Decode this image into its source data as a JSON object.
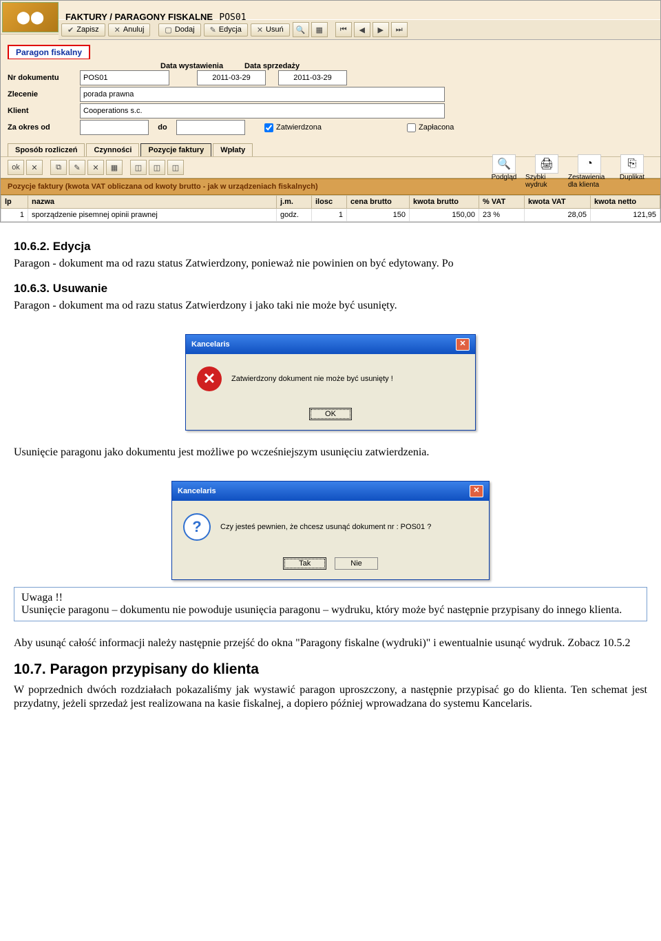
{
  "app": {
    "title": "FAKTURY / PARAGONY FISKALNE",
    "posno": "POS01",
    "toolbar": {
      "zapisz": "Zapisz",
      "anuluj": "Anuluj",
      "dodaj": "Dodaj",
      "edycja": "Edycja",
      "usun": "Usuń"
    },
    "tab": "Paragon fiskalny",
    "labels": {
      "nrdok": "Nr dokumentu",
      "data_wyst": "Data wystawienia",
      "data_sprz": "Data sprzedaży",
      "zlecenie": "Zlecenie",
      "klient": "Klient",
      "zaokres": "Za okres od",
      "do": "do",
      "zatw": "Zatwierdzona",
      "zapl": "Zapłacona"
    },
    "values": {
      "nrdok": "POS01",
      "data_wyst": "2011-03-29",
      "data_sprz": "2011-03-29",
      "zlecenie": "porada prawna",
      "klient": "Cooperations s.c.",
      "od": "",
      "do": ""
    },
    "bigbuttons": {
      "podglad": "Podgląd",
      "szybki": "Szybki wydruk",
      "zest": "Zestawienia dla klienta",
      "dupl": "Duplikat"
    },
    "subtabs": [
      "Sposób rozliczeń",
      "Czynności",
      "Pozycje faktury",
      "Wpłaty"
    ],
    "sectheader": "Pozycje faktury (kwota VAT obliczana od kwoty brutto - jak w urządzeniach fiskalnych)",
    "cols": {
      "lp": "lp",
      "nazwa": "nazwa",
      "jm": "j.m.",
      "ilosc": "ilosc",
      "cenab": "cena brutto",
      "kwotab": "kwota brutto",
      "vat": "% VAT",
      "kwotavat": "kwota VAT",
      "kwotan": "kwota netto"
    },
    "row": {
      "lp": "1",
      "nazwa": "sporządzenie pisemnej opinii prawnej",
      "jm": "godz.",
      "ilosc": "1",
      "cenab": "150",
      "kwotab": "150,00",
      "vat": "23 %",
      "kwotavat": "28,05",
      "kwotan": "121,95"
    }
  },
  "doc": {
    "h_1062": "10.6.2.   Edycja",
    "p_1062": "Paragon - dokument ma od razu status Zatwierdzony, ponieważ nie powinien on być edytowany. Po",
    "h_1063": "10.6.3.   Usuwanie",
    "p_1063": "Paragon - dokument ma od razu status Zatwierdzony i jako taki nie może być usunięty.",
    "p_after1": "Usunięcie paragonu jako dokumentu jest możliwe po wcześniejszym usunięciu zatwierdzenia.",
    "note_h": "Uwaga !!",
    "note_p": "Usunięcie paragonu – dokumentu nie powoduje usunięcia paragonu – wydruku, który może być następnie przypisany do innego klienta.",
    "p_after2": "Aby usunąć całość informacji należy następnie przejść do okna \"Paragony fiskalne (wydruki)\" i ewentualnie usunąć wydruk. Zobacz 10.5.2",
    "h_107": "10.7.        Paragon przypisany do klienta",
    "p_107": "W poprzednich dwóch rozdziałach pokazaliśmy jak wystawić paragon uproszczony, a następnie przypisać go do klienta. Ten schemat jest przydatny, jeżeli sprzedaż jest realizowana na kasie fiskalnej, a dopiero później wprowadzana do systemu Kancelaris."
  },
  "dlg1": {
    "title": "Kancelaris",
    "msg": "Zatwierdzony dokument nie może być usunięty !",
    "ok": "OK"
  },
  "dlg2": {
    "title": "Kancelaris",
    "msg": "Czy jesteś pewnien, że chcesz usunąć dokument nr : POS01 ?",
    "yes": "Tak",
    "no": "Nie"
  }
}
